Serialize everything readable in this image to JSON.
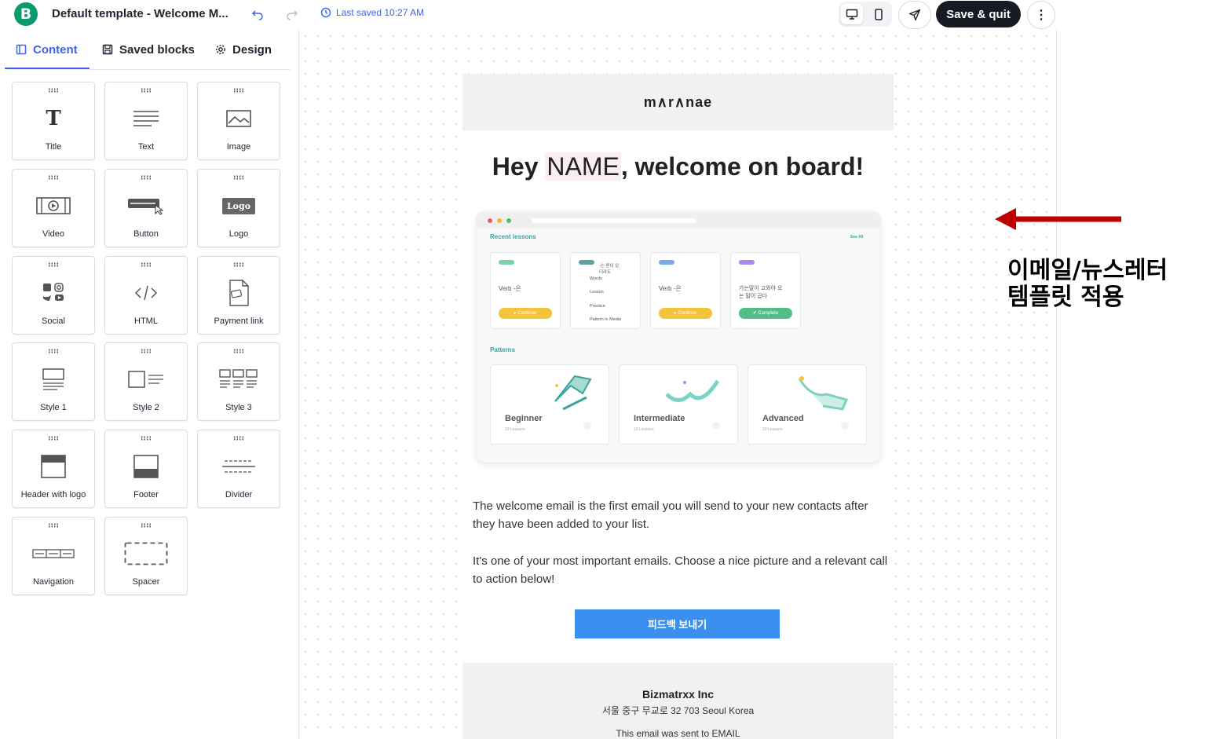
{
  "topbar": {
    "app_logo_letter": "B",
    "doc_title": "Default template - Welcome M...",
    "last_saved": "Last saved 10:27 AM",
    "save_label": "Save & quit",
    "more_label": "⋮"
  },
  "sidebar": {
    "tabs": [
      {
        "label": "Content",
        "icon": "layout-icon",
        "active": true
      },
      {
        "label": "Saved blocks",
        "icon": "save-icon"
      },
      {
        "label": "Design",
        "icon": "gear-icon"
      }
    ],
    "blocks": [
      {
        "label": "Title",
        "icon": "title-icon"
      },
      {
        "label": "Text",
        "icon": "text-icon"
      },
      {
        "label": "Image",
        "icon": "image-icon"
      },
      {
        "label": "Video",
        "icon": "video-icon"
      },
      {
        "label": "Button",
        "icon": "button-icon"
      },
      {
        "label": "Logo",
        "icon": "logo-icon",
        "icon_text": "Logo"
      },
      {
        "label": "Social",
        "icon": "social-icon"
      },
      {
        "label": "HTML",
        "icon": "code-icon"
      },
      {
        "label": "Payment link",
        "icon": "payment-icon"
      },
      {
        "label": "Style 1",
        "icon": "style1-icon"
      },
      {
        "label": "Style 2",
        "icon": "style2-icon"
      },
      {
        "label": "Style 3",
        "icon": "style3-icon"
      },
      {
        "label": "Header with logo",
        "icon": "header-icon"
      },
      {
        "label": "Footer",
        "icon": "footer-icon"
      },
      {
        "label": "Divider",
        "icon": "divider-icon"
      },
      {
        "label": "Navigation",
        "icon": "navigation-icon"
      },
      {
        "label": "Spacer",
        "icon": "spacer-icon"
      }
    ]
  },
  "email": {
    "brand": "m∧r∧nae",
    "headline_pre": "Hey ",
    "headline_name": "NAME",
    "headline_post": ", welcome on board!",
    "hero": {
      "recent_lessons": "Recent lessons",
      "see_all": "See All",
      "lessons": [
        {
          "text": "Verb -은",
          "button": "▸ Continue"
        },
        {
          "text": "-는 편이 있\n더라도",
          "items": [
            "Words",
            "Lesson",
            "Practice",
            "Pattern in Media"
          ]
        },
        {
          "text": "Verb -은",
          "button": "▸ Continue"
        },
        {
          "text": "가는말이 고와야 오\n는 말이 곱다",
          "button": "✔ Complete"
        }
      ],
      "patterns_label": "Patterns",
      "patterns": [
        {
          "name": "Beginner",
          "sub": "10 Lessons"
        },
        {
          "name": "Intermediate",
          "sub": "10 Lessons"
        },
        {
          "name": "Advanced",
          "sub": "10 Lessons"
        }
      ]
    },
    "paragraph1": "The welcome email is the first email you will send to your new contacts after they have been added to your list.",
    "paragraph2": "It's one of your most important emails. Choose a nice picture and a relevant call to action below!",
    "cta_label": "피드백 보내기",
    "footer": {
      "company": "Bizmatrxx Inc",
      "address": "서울 중구 무교로 32 703 Seoul Korea",
      "sent_to": "This email was sent to EMAIL"
    }
  },
  "annotation": {
    "line1": "이메일/뉴스레터",
    "line2": "템플릿 적용",
    "arrow_color": "#c00000"
  },
  "colors": {
    "accent": "#3f63f0",
    "brand_green": "#0b996e",
    "cta_blue": "#3b8fef",
    "dark": "#151a23"
  }
}
